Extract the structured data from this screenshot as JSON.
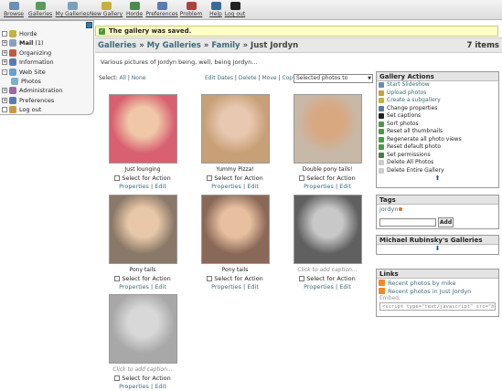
{
  "toolbar": {
    "items": [
      {
        "label": "Browse",
        "color": "#6d8fb0"
      },
      {
        "label": "Galleries",
        "color": "#5a9a5a"
      },
      {
        "label": "My Galleries",
        "color": "#7aa0c0"
      },
      {
        "label": "New Gallery",
        "color": "#c8b040"
      },
      {
        "label": "Horde",
        "color": "#4c8a4c"
      },
      {
        "label": "Preferences",
        "color": "#5a7ab0"
      },
      {
        "label": "Problem",
        "color": "#b04040"
      },
      {
        "label": "Help",
        "color": "#3a6a9a"
      },
      {
        "label": "Log out",
        "color": "#222222"
      }
    ]
  },
  "sidebar": {
    "items": [
      {
        "label": "Horde",
        "expander": "",
        "color": "#c8b040"
      },
      {
        "label": "Mail",
        "count": "(1)",
        "expander": "+",
        "color": "#8aa0c0"
      },
      {
        "label": "Organizing",
        "expander": "+",
        "color": "#c05a3a"
      },
      {
        "label": "Information",
        "expander": "+",
        "color": "#5a7ab0"
      },
      {
        "label": "Web Site",
        "expander": "-",
        "color": "#6aa0c8"
      },
      {
        "label": "Photos",
        "expander": "",
        "color": "#7ab0d0"
      },
      {
        "label": "Administration",
        "expander": "+",
        "color": "#9a6aa0"
      },
      {
        "label": "Preferences",
        "expander": "+",
        "color": "#5a7ab0"
      },
      {
        "label": "Log out",
        "expander": "",
        "color": "#c89a40"
      }
    ]
  },
  "notice": {
    "text": "The gallery was saved."
  },
  "breadcrumb": {
    "galleries": "Galleries",
    "sep": "»",
    "my_galleries": "My Galleries",
    "family": "Family",
    "current": "Just Jordyn",
    "items_count": "7 items"
  },
  "description": "Various pictures of Jordyn being, well, being Jordyn...",
  "actions_bar": {
    "select_label": "Select:",
    "all": "All",
    "none": "None",
    "edit_dates": "Edit Dates",
    "delete": "Delete",
    "move": "Move",
    "copy": "Copy",
    "selected_photos_to": "Selected photos to",
    "pipe": "|"
  },
  "photos": [
    {
      "caption": "Just lounging",
      "caption_empty": false,
      "bg": "#d86070",
      "fg": "#f0c8a8"
    },
    {
      "caption": "Yummy Pizza!",
      "caption_empty": false,
      "bg": "#c8a078",
      "fg": "#e8c8b0"
    },
    {
      "caption": "Double pony tails!",
      "caption_empty": false,
      "bg": "#c8b8a8",
      "fg": "#d8a880"
    },
    {
      "caption": "Pony tails",
      "caption_empty": false,
      "bg": "#8a7868",
      "fg": "#e8c8a8"
    },
    {
      "caption": "Pony tails",
      "caption_empty": false,
      "bg": "#8a6858",
      "fg": "#e8c0a0"
    },
    {
      "caption": "Click to add caption...",
      "caption_empty": true,
      "bg": "#606060",
      "fg": "#c8c8c8"
    },
    {
      "caption": "Click to add caption...",
      "caption_empty": true,
      "bg": "#a8a8a8",
      "fg": "#d8d8d8"
    }
  ],
  "photo_common": {
    "select_label": "Select for Action",
    "properties": "Properties",
    "edit": "Edit",
    "sep": "|"
  },
  "gallery_actions": {
    "title": "Gallery Actions",
    "items": [
      {
        "label": "Start Slideshow",
        "link": true,
        "color": "#6a8ab0"
      },
      {
        "label": "Upload photos",
        "link": true,
        "color": "#c8a040"
      },
      {
        "label": "Create a subgallery",
        "link": true,
        "color": "#c8b040"
      },
      {
        "label": "Change properties",
        "link": false,
        "color": "#5a7aa0"
      },
      {
        "label": "Set captions",
        "link": false,
        "color": "#222222"
      },
      {
        "label": "Sort photos",
        "link": false,
        "color": "#4a9a4a"
      },
      {
        "label": "Reset all thumbnails",
        "link": false,
        "color": "#4a9a4a"
      },
      {
        "label": "Regenerate all photo views",
        "link": false,
        "color": "#4a9a4a"
      },
      {
        "label": "Reset default photo",
        "link": false,
        "color": "#4a9a4a"
      },
      {
        "label": "Set permissions",
        "link": false,
        "color": "#4a7a4a"
      },
      {
        "label": "Delete All Photos",
        "link": false,
        "color": "#cccccc"
      },
      {
        "label": "Delete Entire Gallery",
        "link": false,
        "color": "#cccccc"
      }
    ]
  },
  "tags": {
    "title": "Tags",
    "tag": "jordyn",
    "add_label": "Add"
  },
  "other_galleries": {
    "title": "Michael Rubinsky's Galleries"
  },
  "links": {
    "title": "Links",
    "items": [
      "Recent photos by mike",
      "Recent photos in Just Jordyn"
    ],
    "embed_label": "Embed:",
    "embed_code": "<script type=\"text/javascript\" src=\"http"
  }
}
